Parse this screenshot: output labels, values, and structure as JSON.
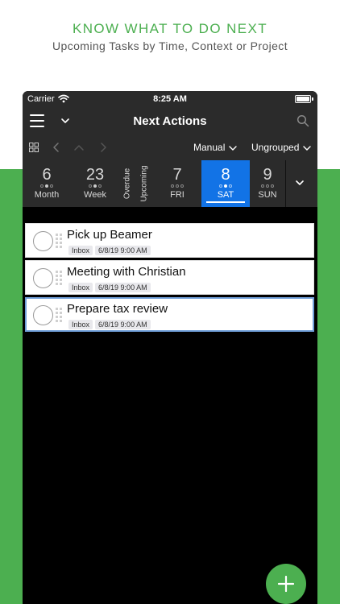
{
  "promo": {
    "title": "KNOW WHAT TO DO NEXT",
    "subtitle": "Upcoming Tasks by Time, Context or Project"
  },
  "status_bar": {
    "carrier": "Carrier",
    "time": "8:25 AM"
  },
  "nav": {
    "title": "Next Actions"
  },
  "toolbar": {
    "sort": "Manual",
    "group": "Ungrouped"
  },
  "date_strip": {
    "cells": [
      {
        "num": "6",
        "label": "Month"
      },
      {
        "num": "23",
        "label": "Week"
      },
      {
        "num": "7",
        "label": "FRI"
      },
      {
        "num": "8",
        "label": "SAT"
      },
      {
        "num": "9",
        "label": "SUN"
      }
    ],
    "vertical": [
      "Overdue",
      "Upcoming"
    ],
    "selected": "SAT"
  },
  "tasks": [
    {
      "title": "Pick up Beamer",
      "tags": [
        "Inbox",
        "6/8/19 9:00 AM"
      ]
    },
    {
      "title": "Meeting with Christian",
      "tags": [
        "Inbox",
        "6/8/19 9:00 AM"
      ]
    },
    {
      "title": "Prepare tax review",
      "tags": [
        "Inbox",
        "6/8/19 9:00 AM"
      ]
    }
  ],
  "colors": {
    "accent_green": "#4caf50",
    "selected_blue": "#1273e6",
    "bar_dark": "#2b2b2b"
  },
  "icons": [
    "wifi-icon",
    "battery-icon",
    "menu-icon",
    "chevron-down-icon",
    "search-icon",
    "grid-icon",
    "arrow-left-icon",
    "arrow-up-icon",
    "arrow-right-icon",
    "plus-icon"
  ]
}
